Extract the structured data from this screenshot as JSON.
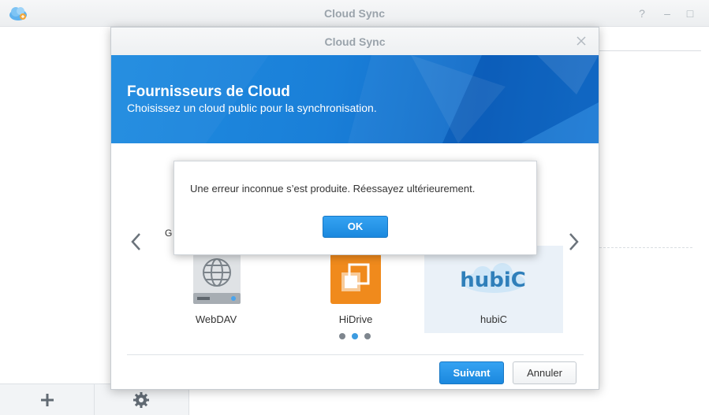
{
  "app": {
    "title": "Cloud Sync",
    "help_symbol": "?",
    "minimize_symbol": "–",
    "maximize_symbol": "□"
  },
  "wizard": {
    "title": "Cloud Sync",
    "banner_title": "Fournisseurs de Cloud",
    "banner_subtitle": "Choisissez un cloud public pour la synchronisation.",
    "partial_label": "G",
    "providers": [
      {
        "name": "WebDAV",
        "icon": "webdav-globe-icon",
        "selected": false
      },
      {
        "name": "HiDrive",
        "icon": "hidrive-icon",
        "selected": false
      },
      {
        "name": "hubiC",
        "icon": "hubic-logo-icon",
        "selected": true
      }
    ],
    "page_indicator": {
      "total": 3,
      "active": 2
    },
    "next_label": "Suivant",
    "cancel_label": "Annuler"
  },
  "error_dialog": {
    "message": "Une erreur inconnue s’est produite. Réessayez ultérieurement.",
    "ok_label": "OK"
  },
  "bottom_toolbar": {
    "add_icon": "plus-icon",
    "settings_icon": "gear-icon"
  },
  "colors": {
    "accent": "#1b88de",
    "banner": "#1a7fd8",
    "hidrive": "#f08a1c",
    "hubic": "#2f7fba"
  }
}
